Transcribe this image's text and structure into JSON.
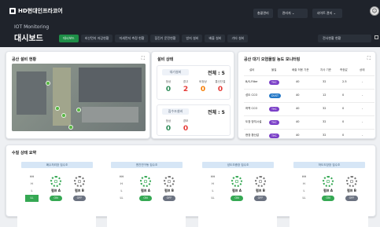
{
  "header": {
    "brand": "HD현대인프라코어",
    "subtitle": "IOT Monitoring",
    "title": "대시보드",
    "user": "총괄관리",
    "role": "관리자",
    "site": "사이트 관리",
    "filter": "전사현황 현황"
  },
  "tabs": [
    {
      "label": "대시보드"
    },
    {
      "label": "비산먼지 저감현황"
    },
    {
      "label": "미세먼지 측정 현황"
    },
    {
      "label": "집진기 운전현황"
    },
    {
      "label": "방지 설비"
    },
    {
      "label": "배출 설비"
    },
    {
      "label": "기타 설비"
    }
  ],
  "map_panel": {
    "title": "공산 설비 현황"
  },
  "equipment": {
    "title": "설비 상태",
    "cards": [
      {
        "label": "대기설비",
        "total": "전체 : 5",
        "stats": [
          {
            "label": "정상",
            "value": "0",
            "color": "#2e8b57"
          },
          {
            "label": "경고",
            "value": "2",
            "color": "#e53935"
          },
          {
            "label": "비정상",
            "value": "0",
            "color": "#f57c00"
          },
          {
            "label": "통신단절",
            "value": "0",
            "color": "#e53935"
          }
        ]
      },
      {
        "label": "집수조설비",
        "total": "전체 : 5",
        "stats": [
          {
            "label": "정상",
            "value": "0",
            "color": "#2e8b57"
          },
          {
            "label": "경보",
            "value": "0",
            "color": "#e53935"
          }
        ]
      }
    ]
  },
  "air_table": {
    "title": "공산 대기 오염물질 농도 모니터링",
    "headers": [
      "설비",
      "물질",
      "배출 허용 기준",
      "자사 기준",
      "측정값",
      "상태"
    ],
    "rows": [
      [
        "B/S-Filter",
        "THC",
        "40",
        "32",
        "2.5",
        "-"
      ],
      [
        "성도 CCO",
        "DUST",
        "40",
        "12",
        "0",
        "-"
      ],
      [
        "하역 CCO",
        "THC",
        "40",
        "32",
        "0",
        "-"
      ],
      [
        "도장 방지시설",
        "THC",
        "40",
        "32",
        "0",
        "-"
      ],
      [
        "현장 환산값",
        "THC",
        "40",
        "32",
        "0",
        "-"
      ]
    ]
  },
  "water": {
    "title": "수질 상태 요약",
    "cards": [
      {
        "title": "폐수처리장 집수조",
        "pumps": [
          {
            "name": "펌프 A",
            "status": "ON"
          },
          {
            "name": "펌프 B",
            "status": "OFF"
          }
        ]
      },
      {
        "title": "엔진연구동 집수조",
        "pumps": [
          {
            "name": "펌프 A",
            "status": "ON"
          },
          {
            "name": "펌프 B",
            "status": "OFF"
          }
        ]
      },
      {
        "title": "성도조종장 집수조",
        "pumps": [
          {
            "name": "펌프 A",
            "status": "ON"
          },
          {
            "name": "펌프 B",
            "status": "OFF"
          }
        ]
      },
      {
        "title": "하도도장장 집수조",
        "pumps": [
          {
            "name": "펌프 A",
            "status": "ON"
          },
          {
            "name": "펌프 B",
            "status": "OFF"
          }
        ]
      }
    ]
  },
  "levels": [
    "HH",
    "H",
    "L",
    "LL"
  ]
}
